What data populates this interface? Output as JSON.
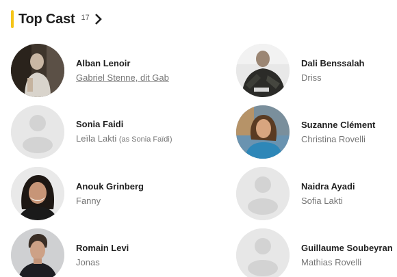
{
  "header": {
    "title": "Top Cast",
    "count": "17",
    "accent_color": "#f5c518",
    "chevron_icon": "chevron-right-icon"
  },
  "cast": [
    {
      "actor": "Alban Lenoir",
      "role": "Gabriel Stenne, dit Gab",
      "note": "",
      "photo": "photo",
      "role_link": true
    },
    {
      "actor": "Dali Benssalah",
      "role": "Driss",
      "note": "",
      "photo": "photo",
      "role_link": false
    },
    {
      "actor": "Sonia Faidi",
      "role": "Leïla Lakti",
      "note": "(as Sonia Faïdi)",
      "photo": "placeholder",
      "role_link": false
    },
    {
      "actor": "Suzanne Clément",
      "role": "Christina Rovelli",
      "note": "",
      "photo": "photo",
      "role_link": false
    },
    {
      "actor": "Anouk Grinberg",
      "role": "Fanny",
      "note": "",
      "photo": "photo",
      "role_link": false
    },
    {
      "actor": "Naidra Ayadi",
      "role": "Sofia Lakti",
      "note": "",
      "photo": "placeholder",
      "role_link": false
    },
    {
      "actor": "Romain Levi",
      "role": "Jonas",
      "note": "",
      "photo": "photo",
      "role_link": false
    },
    {
      "actor": "Guillaume Soubeyran",
      "role": "Mathias Rovelli",
      "note": "",
      "photo": "placeholder",
      "role_link": false
    }
  ]
}
